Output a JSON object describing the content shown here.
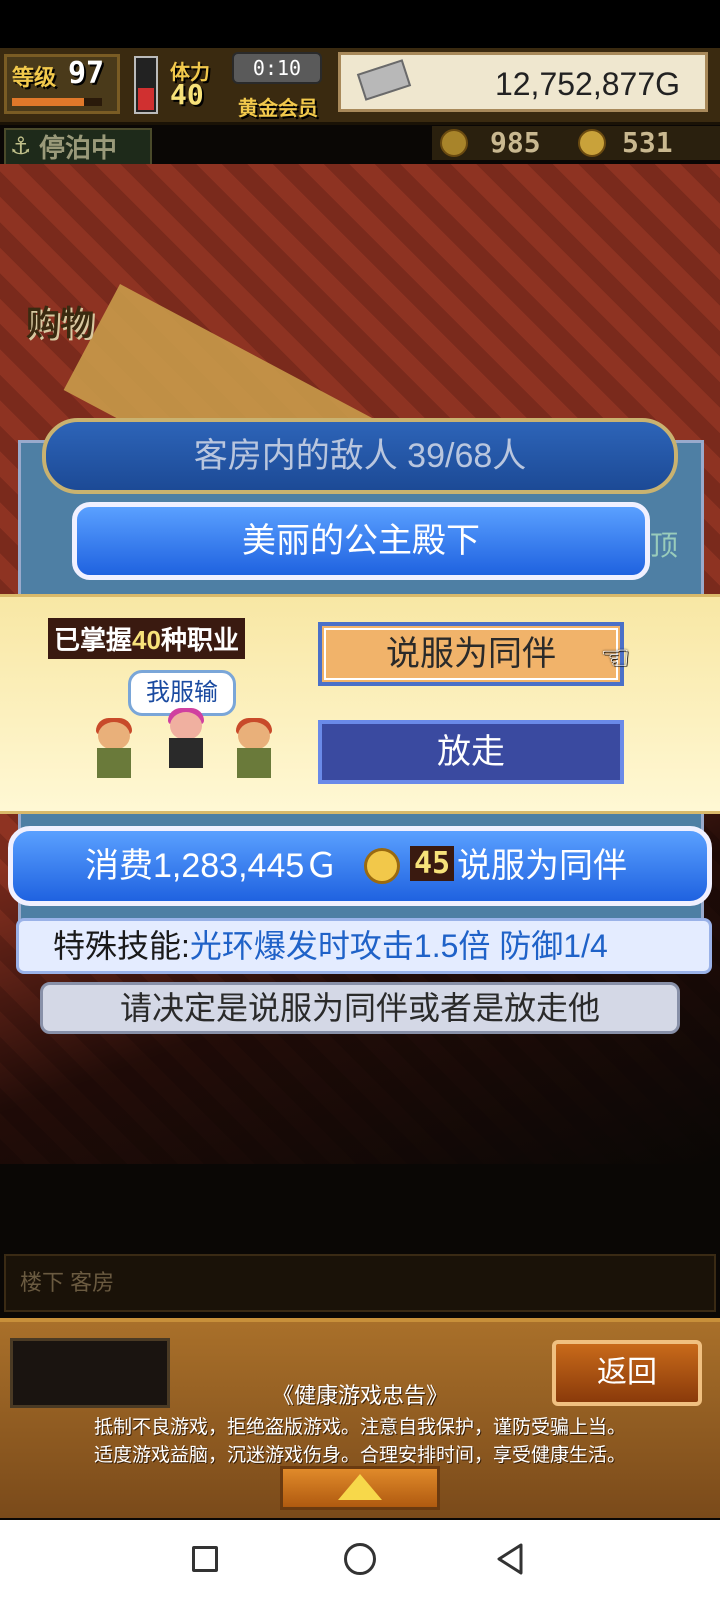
{
  "hud": {
    "level_label": "等级",
    "level_value": "97",
    "level_progress": 0.8,
    "stamina_label": "体力",
    "stamina_value": "40",
    "stamina_fill": 0.45,
    "timer": "0:10",
    "membership": "黄金会员",
    "money": "12,752,877G",
    "status": "停泊中",
    "resource_1": "985",
    "resource_2": "531"
  },
  "background": {
    "shop_sign": "购物"
  },
  "dialog": {
    "enemy_count": "客房内的敌人  39/68人",
    "target_name": "美丽的公主殿下",
    "side_text": "顶",
    "mastered_prefix": "已掌握",
    "mastered_count": "40",
    "mastered_suffix": "种职业",
    "speech": "我服输",
    "persuade_label": "说服为同伴",
    "release_label": "放走",
    "cost_text": "消费1,283,445Ｇ",
    "cost_coins": "45",
    "cost_action": "说服为同伴",
    "skill_label": "特殊技能:",
    "skill_desc": "光环爆发时攻击1.5倍 防御1/4",
    "decide_text": "请决定是说服为同伴或者是放走他"
  },
  "bottom": {
    "floor_label": "楼下 客房",
    "back_label": "返回",
    "notice_title": "《健康游戏忠告》",
    "notice_line1": "抵制不良游戏，拒绝盗版游戏。注意自我保护，谨防受骗上当。",
    "notice_line2": "适度游戏益脑，沉迷游戏伤身。合理安排时间，享受健康生活。"
  },
  "colors": {
    "accent_blue": "#1f62e0",
    "gold": "#f7e27a",
    "persuade_orange": "#f1b36a",
    "release_indigo": "#3a4aa0"
  },
  "icons": [
    "anchor-icon",
    "silver-bar-icon",
    "gear-coin-icon",
    "gold-coin-icon",
    "pointing-hand-icon",
    "up-arrow-icon",
    "nav-square-icon",
    "nav-circle-icon",
    "nav-back-icon"
  ]
}
